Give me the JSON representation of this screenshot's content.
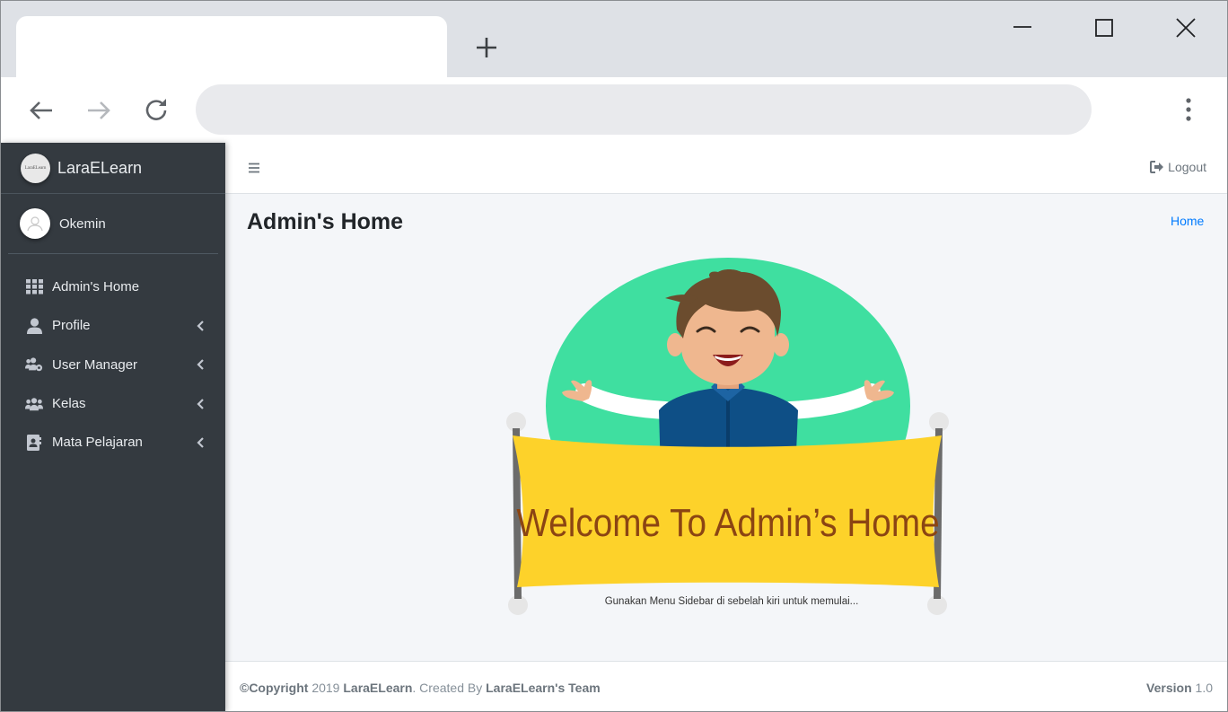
{
  "browser": {
    "new_tab_icon": "plus-icon",
    "minimize_icon": "minimize-icon",
    "maximize_icon": "maximize-icon",
    "close_icon": "close-icon",
    "back_icon": "arrow-left-icon",
    "forward_icon": "arrow-right-icon",
    "reload_icon": "reload-icon",
    "menu_icon": "more-vertical-icon"
  },
  "brand": {
    "logo_text": "LaraELearn",
    "name": "LaraELearn"
  },
  "user": {
    "name": "Okemin"
  },
  "sidebar": {
    "items": [
      {
        "label": "Admin's Home",
        "icon": "grid-icon",
        "has_submenu": false
      },
      {
        "label": "Profile",
        "icon": "user-icon",
        "has_submenu": true
      },
      {
        "label": "User Manager",
        "icon": "users-cog-icon",
        "has_submenu": true
      },
      {
        "label": "Kelas",
        "icon": "users-icon",
        "has_submenu": true
      },
      {
        "label": "Mata Pelajaran",
        "icon": "address-book-icon",
        "has_submenu": true
      }
    ]
  },
  "topnav": {
    "logout_label": "Logout"
  },
  "header": {
    "title": "Admin's Home",
    "breadcrumb": "Home"
  },
  "banner": {
    "headline": "Welcome To Admin’s Home",
    "subtext": "Gunakan Menu Sidebar di sebelah kiri untuk memulai..."
  },
  "footer": {
    "copyright_label": "©Copyright",
    "year": "2019",
    "app_name": "LaraELearn",
    "created_by": ". Created By",
    "team": "LaraELearn's Team",
    "version_label": "Version",
    "version_value": "1.0"
  },
  "colors": {
    "sidebar_bg": "#343a40",
    "link": "#007bff",
    "banner_yellow": "#fdd22a",
    "circle_green": "#3fdfa0",
    "banner_text": "#8b4513"
  }
}
